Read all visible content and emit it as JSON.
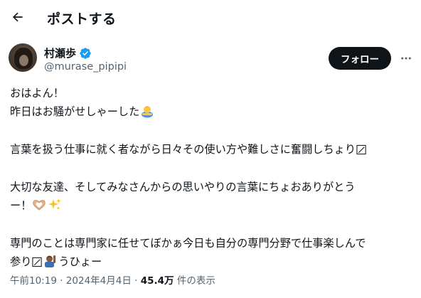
{
  "header": {
    "title": "ポストする"
  },
  "author": {
    "display_name": "村瀬歩",
    "handle": "@murase_pipipi",
    "verified": true,
    "follow_label": "フォロー"
  },
  "tweet": {
    "lines": [
      "おはよん！",
      "昨日はお騒がせしゃーした",
      "",
      "言葉を扱う仕事に就く者ながら日々その使い方や難しさに奮闘しちょり",
      "",
      "大切な友達、そしてみなさんからの思いやりの言葉にちょおありがとう",
      "ー！",
      "",
      "専門のことは専門家に任せてぼかぁ今日も自分の専門分野で仕事楽しんで",
      "参り",
      "うひょー"
    ]
  },
  "meta": {
    "time": "午前10:19",
    "separator": "·",
    "date": "2024年4月4日",
    "views": "45.4万",
    "views_label": "件の表示"
  },
  "colors": {
    "text": "#0f1419",
    "secondary": "#536471",
    "verified": "#1d9bf0",
    "follow_bg": "#0f1419"
  },
  "icons": [
    "back-arrow-icon",
    "verified-badge-icon",
    "more-dots-icon",
    "person-bowing-emoji",
    "ballot-box-check-icon",
    "heart-hands-emoji",
    "sparkles-emoji",
    "person-raising-hand-emoji"
  ]
}
